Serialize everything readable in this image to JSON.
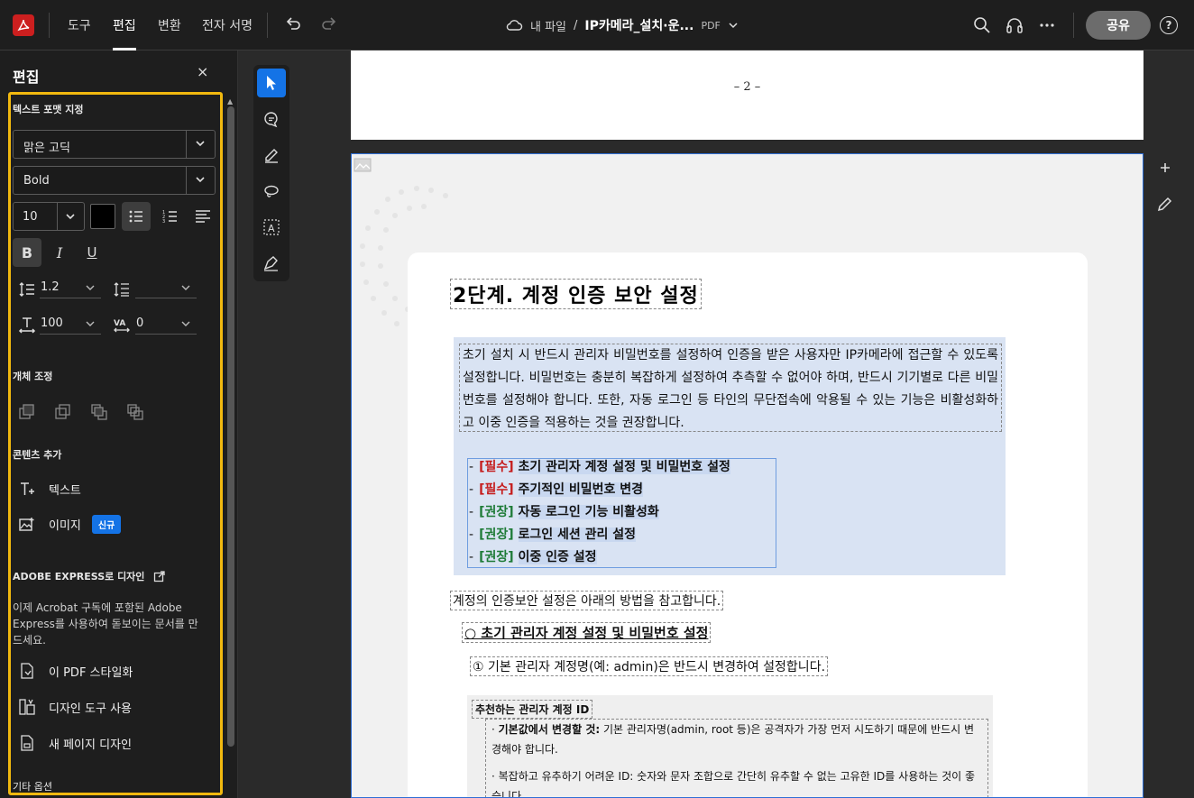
{
  "topbar": {
    "menu": [
      "도구",
      "편집",
      "변환",
      "전자 서명"
    ],
    "active_menu": "편집",
    "breadcrumb": "내 파일",
    "separator": "/",
    "filename": "IP카메라_설치·운...",
    "filetype": "PDF",
    "share_label": "공유",
    "help_label": "?"
  },
  "panel": {
    "title": "편집",
    "close": "×",
    "text_format_label": "텍스트 포맷 지정",
    "font_family": "맑은 고딕",
    "font_weight": "Bold",
    "font_size": "10",
    "text_color": "#000000",
    "bold": "B",
    "italic": "I",
    "underline": "U",
    "line_spacing": "1.2",
    "paragraph_spacing": "",
    "horizontal_scale": "100",
    "char_spacing": "0",
    "object_label": "개체 조정",
    "add_content_label": "콘텐츠 추가",
    "add_text": "텍스트",
    "add_image": "이미지",
    "new_badge": "신규",
    "express_label": "ADOBE EXPRESS로 디자인",
    "express_desc": "이제 Acrobat 구독에 포함된 Adobe Express를 사용하여 돋보이는 문서를 만드세요.",
    "stylize": "이 PDF 스타일화",
    "design_tools": "디자인 도구 사용",
    "new_page_design": "새 페이지 디자인",
    "other_options": "기타 옵션"
  },
  "document": {
    "page_number": "– 2 –",
    "heading": "2단계. 계정 인증 보안 설정",
    "paragraph": "초기 설치 시 반드시 관리자 비밀번호를 설정하여 인증을 받은 사용자만 IP카메라에 접근할 수 있도록 설정합니다. 비밀번호는 충분히 복잡하게 설정하여 추측할 수 없어야 하며, 반드시 기기별로 다른 비밀번호를 설정해야 합니다. 또한, 자동 로그인 등 타인의 무단접속에 악용될 수 있는 기능은 비활성화하고 이중 인증을 적용하는 것을 권장합니다.",
    "list": [
      {
        "tag": "[필수]",
        "kind": "req",
        "text": "초기 관리자 계정 설정 및 비밀번호 설정"
      },
      {
        "tag": "[필수]",
        "kind": "req",
        "text": "주기적인 비밀번호 변경"
      },
      {
        "tag": "[권장]",
        "kind": "rec",
        "text": "자동 로그인 기능 비활성화"
      },
      {
        "tag": "[권장]",
        "kind": "rec",
        "text": "로그인 세션 관리 설정"
      },
      {
        "tag": "[권장]",
        "kind": "rec",
        "text": "이중 인증 설정"
      }
    ],
    "refer": "계정의 인증보안 설정은 아래의 방법을 참고합니다.",
    "section": "○ 초기 관리자 계정 설정 및 비밀번호 설정",
    "step1": "① 기본 관리자 계정명(예: admin)은 반드시 변경하여 설정합니다.",
    "recommend_title": "추천하는 관리자 계정 ID",
    "bullet1_bold": "기본값에서 변경할 것:",
    "bullet1_rest": " 기본 관리자명(admin, root 등)은 공격자가 가장 먼저 시도하기 때문에 반드시 변경해야 합니다.",
    "bullet2": "복잡하고 유추하기 어려운 ID: 숫자와 문자 조합으로 간단히 유추할 수 없는 고유한 ID를 사용하는 것이 좋습니다."
  },
  "colors": {
    "accent": "#1473e6",
    "highlight_border": "#f2b90f",
    "required": "#c51c1c",
    "recommended": "#1e7b37"
  }
}
